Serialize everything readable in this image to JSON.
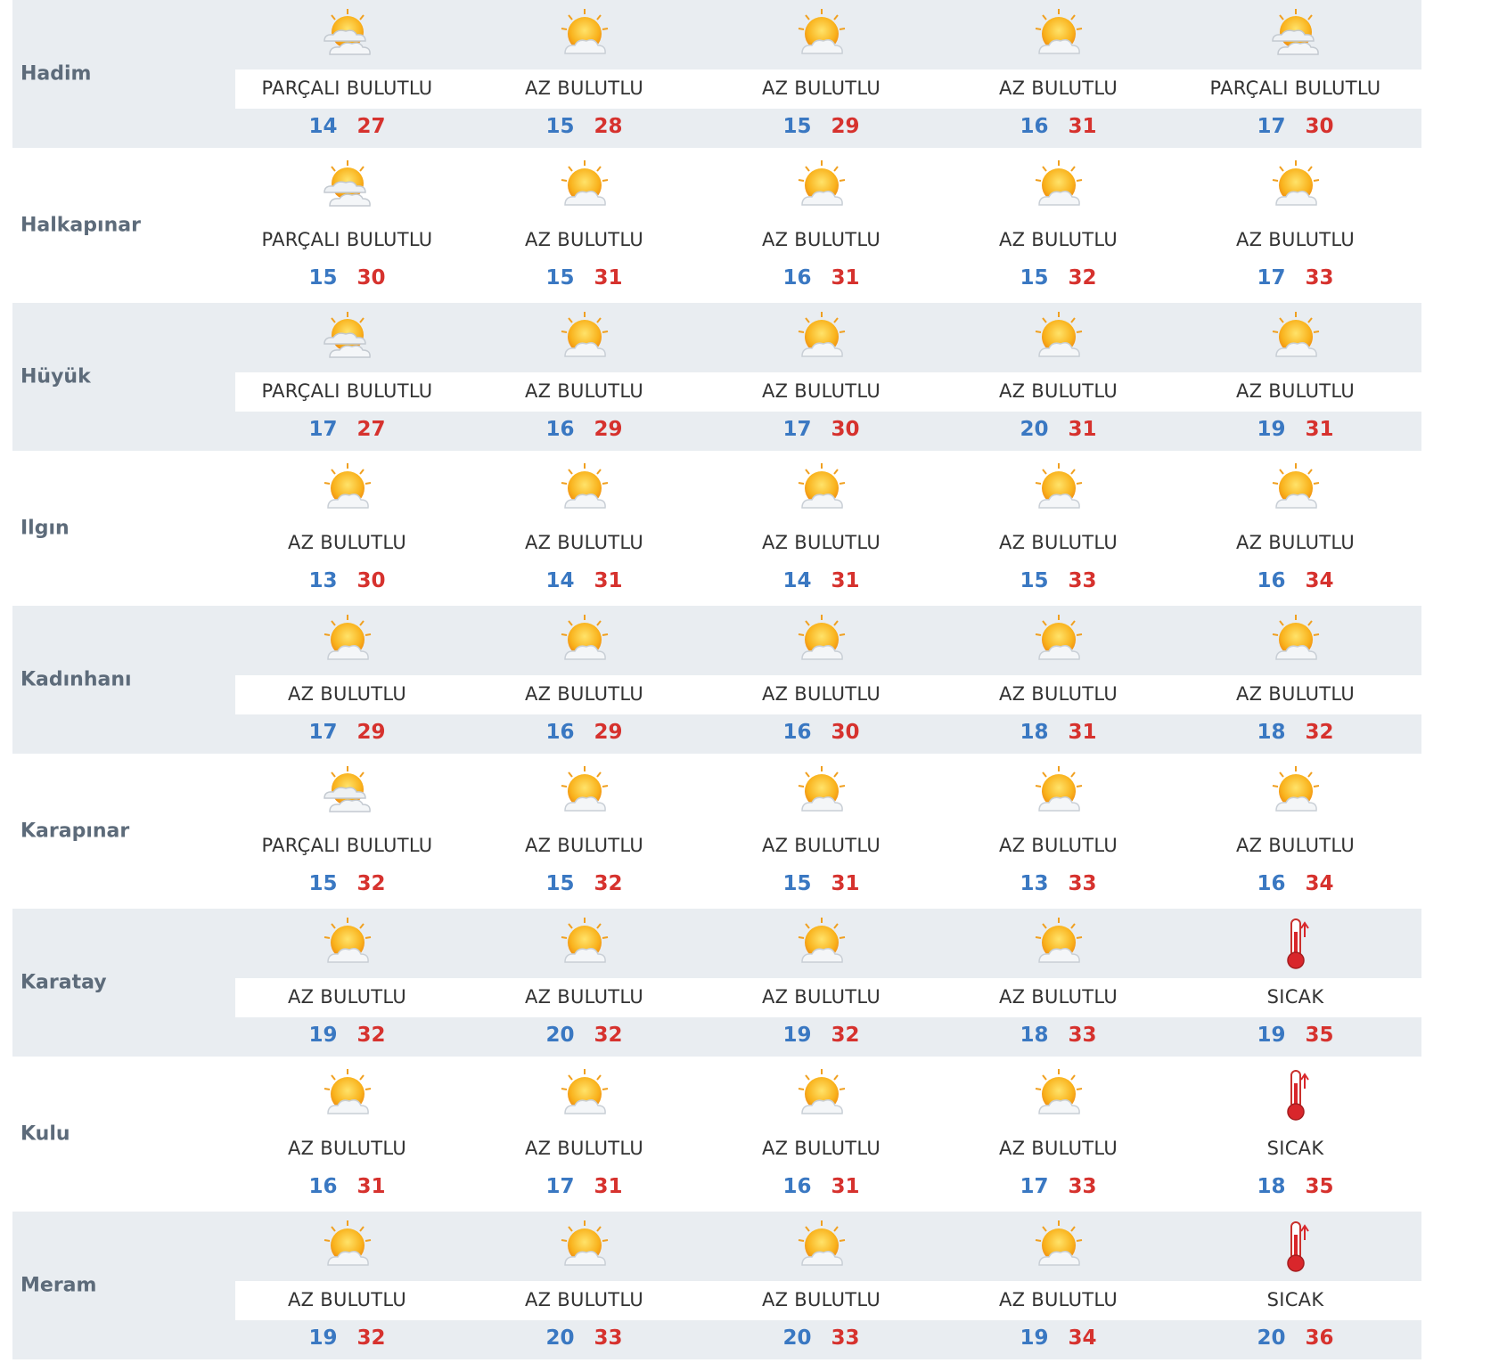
{
  "rows": [
    {
      "name": "Hadim",
      "days": [
        {
          "icon": "partly-cloudy-icon",
          "cond": "PARÇALI BULUTLU",
          "lo": "14",
          "hi": "27"
        },
        {
          "icon": "mostly-sunny-icon",
          "cond": "AZ BULUTLU",
          "lo": "15",
          "hi": "28"
        },
        {
          "icon": "mostly-sunny-icon",
          "cond": "AZ BULUTLU",
          "lo": "15",
          "hi": "29"
        },
        {
          "icon": "mostly-sunny-icon",
          "cond": "AZ BULUTLU",
          "lo": "16",
          "hi": "31"
        },
        {
          "icon": "partly-cloudy-icon",
          "cond": "PARÇALI BULUTLU",
          "lo": "17",
          "hi": "30"
        }
      ]
    },
    {
      "name": "Halkapınar",
      "days": [
        {
          "icon": "partly-cloudy-icon",
          "cond": "PARÇALI BULUTLU",
          "lo": "15",
          "hi": "30"
        },
        {
          "icon": "mostly-sunny-icon",
          "cond": "AZ BULUTLU",
          "lo": "15",
          "hi": "31"
        },
        {
          "icon": "mostly-sunny-icon",
          "cond": "AZ BULUTLU",
          "lo": "16",
          "hi": "31"
        },
        {
          "icon": "mostly-sunny-icon",
          "cond": "AZ BULUTLU",
          "lo": "15",
          "hi": "32"
        },
        {
          "icon": "mostly-sunny-icon",
          "cond": "AZ BULUTLU",
          "lo": "17",
          "hi": "33"
        }
      ]
    },
    {
      "name": "Hüyük",
      "days": [
        {
          "icon": "partly-cloudy-icon",
          "cond": "PARÇALI BULUTLU",
          "lo": "17",
          "hi": "27"
        },
        {
          "icon": "mostly-sunny-icon",
          "cond": "AZ BULUTLU",
          "lo": "16",
          "hi": "29"
        },
        {
          "icon": "mostly-sunny-icon",
          "cond": "AZ BULUTLU",
          "lo": "17",
          "hi": "30"
        },
        {
          "icon": "mostly-sunny-icon",
          "cond": "AZ BULUTLU",
          "lo": "20",
          "hi": "31"
        },
        {
          "icon": "mostly-sunny-icon",
          "cond": "AZ BULUTLU",
          "lo": "19",
          "hi": "31"
        }
      ]
    },
    {
      "name": "Ilgın",
      "days": [
        {
          "icon": "mostly-sunny-icon",
          "cond": "AZ BULUTLU",
          "lo": "13",
          "hi": "30"
        },
        {
          "icon": "mostly-sunny-icon",
          "cond": "AZ BULUTLU",
          "lo": "14",
          "hi": "31"
        },
        {
          "icon": "mostly-sunny-icon",
          "cond": "AZ BULUTLU",
          "lo": "14",
          "hi": "31"
        },
        {
          "icon": "mostly-sunny-icon",
          "cond": "AZ BULUTLU",
          "lo": "15",
          "hi": "33"
        },
        {
          "icon": "mostly-sunny-icon",
          "cond": "AZ BULUTLU",
          "lo": "16",
          "hi": "34"
        }
      ]
    },
    {
      "name": "Kadınhanı",
      "days": [
        {
          "icon": "mostly-sunny-icon",
          "cond": "AZ BULUTLU",
          "lo": "17",
          "hi": "29"
        },
        {
          "icon": "mostly-sunny-icon",
          "cond": "AZ BULUTLU",
          "lo": "16",
          "hi": "29"
        },
        {
          "icon": "mostly-sunny-icon",
          "cond": "AZ BULUTLU",
          "lo": "16",
          "hi": "30"
        },
        {
          "icon": "mostly-sunny-icon",
          "cond": "AZ BULUTLU",
          "lo": "18",
          "hi": "31"
        },
        {
          "icon": "mostly-sunny-icon",
          "cond": "AZ BULUTLU",
          "lo": "18",
          "hi": "32"
        }
      ]
    },
    {
      "name": "Karapınar",
      "days": [
        {
          "icon": "partly-cloudy-icon",
          "cond": "PARÇALI BULUTLU",
          "lo": "15",
          "hi": "32"
        },
        {
          "icon": "mostly-sunny-icon",
          "cond": "AZ BULUTLU",
          "lo": "15",
          "hi": "32"
        },
        {
          "icon": "mostly-sunny-icon",
          "cond": "AZ BULUTLU",
          "lo": "15",
          "hi": "31"
        },
        {
          "icon": "mostly-sunny-icon",
          "cond": "AZ BULUTLU",
          "lo": "13",
          "hi": "33"
        },
        {
          "icon": "mostly-sunny-icon",
          "cond": "AZ BULUTLU",
          "lo": "16",
          "hi": "34"
        }
      ]
    },
    {
      "name": "Karatay",
      "days": [
        {
          "icon": "mostly-sunny-icon",
          "cond": "AZ BULUTLU",
          "lo": "19",
          "hi": "32"
        },
        {
          "icon": "mostly-sunny-icon",
          "cond": "AZ BULUTLU",
          "lo": "20",
          "hi": "32"
        },
        {
          "icon": "mostly-sunny-icon",
          "cond": "AZ BULUTLU",
          "lo": "19",
          "hi": "32"
        },
        {
          "icon": "mostly-sunny-icon",
          "cond": "AZ BULUTLU",
          "lo": "18",
          "hi": "33"
        },
        {
          "icon": "thermometer-hot-icon",
          "cond": "SICAK",
          "lo": "19",
          "hi": "35"
        }
      ]
    },
    {
      "name": "Kulu",
      "days": [
        {
          "icon": "mostly-sunny-icon",
          "cond": "AZ BULUTLU",
          "lo": "16",
          "hi": "31"
        },
        {
          "icon": "mostly-sunny-icon",
          "cond": "AZ BULUTLU",
          "lo": "17",
          "hi": "31"
        },
        {
          "icon": "mostly-sunny-icon",
          "cond": "AZ BULUTLU",
          "lo": "16",
          "hi": "31"
        },
        {
          "icon": "mostly-sunny-icon",
          "cond": "AZ BULUTLU",
          "lo": "17",
          "hi": "33"
        },
        {
          "icon": "thermometer-hot-icon",
          "cond": "SICAK",
          "lo": "18",
          "hi": "35"
        }
      ]
    },
    {
      "name": "Meram",
      "days": [
        {
          "icon": "mostly-sunny-icon",
          "cond": "AZ BULUTLU",
          "lo": "19",
          "hi": "32"
        },
        {
          "icon": "mostly-sunny-icon",
          "cond": "AZ BULUTLU",
          "lo": "20",
          "hi": "33"
        },
        {
          "icon": "mostly-sunny-icon",
          "cond": "AZ BULUTLU",
          "lo": "20",
          "hi": "33"
        },
        {
          "icon": "mostly-sunny-icon",
          "cond": "AZ BULUTLU",
          "lo": "19",
          "hi": "34"
        },
        {
          "icon": "thermometer-hot-icon",
          "cond": "SICAK",
          "lo": "20",
          "hi": "36"
        }
      ]
    }
  ],
  "colors": {
    "low": "#3a78c2",
    "high": "#d6322e",
    "band": "#e9edf1",
    "label": "#5d6b7a"
  }
}
